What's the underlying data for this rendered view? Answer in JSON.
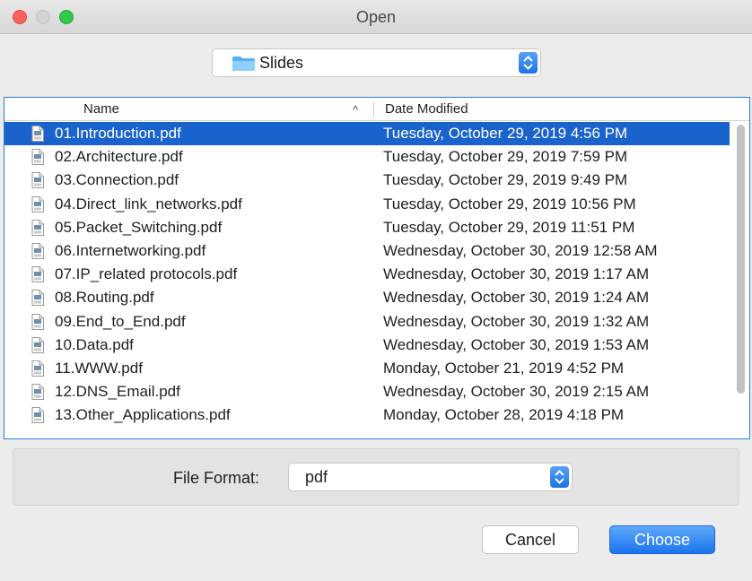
{
  "window": {
    "title": "Open"
  },
  "location": {
    "folder": "Slides",
    "icon": "folder-icon"
  },
  "columns": {
    "name": "Name",
    "date": "Date Modified",
    "sort_indicator": "^"
  },
  "files": [
    {
      "name": "01.Introduction.pdf",
      "date": "Tuesday, October 29, 2019 4:56 PM",
      "selected": true
    },
    {
      "name": "02.Architecture.pdf",
      "date": "Tuesday, October 29, 2019 7:59 PM"
    },
    {
      "name": "03.Connection.pdf",
      "date": "Tuesday, October 29, 2019 9:49 PM"
    },
    {
      "name": "04.Direct_link_networks.pdf",
      "date": "Tuesday, October 29, 2019 10:56 PM"
    },
    {
      "name": "05.Packet_Switching.pdf",
      "date": "Tuesday, October 29, 2019 11:51 PM"
    },
    {
      "name": "06.Internetworking.pdf",
      "date": "Wednesday, October 30, 2019 12:58 AM"
    },
    {
      "name": "07.IP_related protocols.pdf",
      "date": "Wednesday, October 30, 2019 1:17 AM"
    },
    {
      "name": "08.Routing.pdf",
      "date": "Wednesday, October 30, 2019 1:24 AM"
    },
    {
      "name": "09.End_to_End.pdf",
      "date": "Wednesday, October 30, 2019 1:32 AM"
    },
    {
      "name": "10.Data.pdf",
      "date": "Wednesday, October 30, 2019 1:53 AM"
    },
    {
      "name": "11.WWW.pdf",
      "date": "Monday, October 21, 2019 4:52 PM"
    },
    {
      "name": "12.DNS_Email.pdf",
      "date": "Wednesday, October 30, 2019 2:15 AM"
    },
    {
      "name": "13.Other_Applications.pdf",
      "date": "Monday, October 28, 2019 4:18 PM"
    }
  ],
  "file_format": {
    "label": "File Format:",
    "value": "pdf"
  },
  "buttons": {
    "cancel": "Cancel",
    "choose": "Choose"
  },
  "colors": {
    "selection": "#1b63cc",
    "accent": "#1a74ee",
    "close": "#fc605c",
    "maximize": "#34c84a"
  }
}
